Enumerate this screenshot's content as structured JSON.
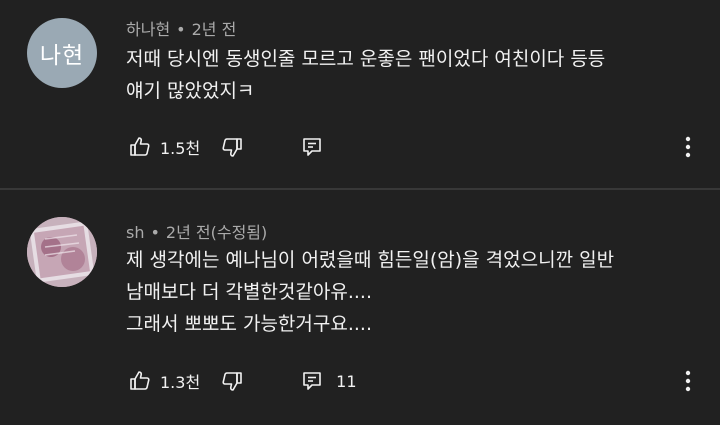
{
  "comments": [
    {
      "avatar_text": "나현",
      "author": "하나현",
      "time": "2년 전",
      "text_lines": [
        "저때 당시엔 동생인줄 모르고 운좋은 팬이었다 여친이다 등등",
        "얘기 많았었지ㅋ"
      ],
      "likes": "1.5천",
      "replies": ""
    },
    {
      "author": "sh",
      "time": "2년 전(수정됨)",
      "text_lines": [
        "제 생각에는 예나님이 어렸을때 힘든일(암)을 격었으니깐 일반",
        "남매보다 더 각별한것같아유....",
        "그래서 뽀뽀도 가능한거구요...."
      ],
      "likes": "1.3천",
      "replies": "11"
    }
  ],
  "colors": {
    "background": "#212121",
    "divider": "#383838",
    "text": "#f1f1f1",
    "meta": "#aaaaaa",
    "avatar1": "#9aa9b4",
    "avatar2": "#b89aa8"
  },
  "icons": [
    "like-icon",
    "dislike-icon",
    "reply-icon",
    "more-options-icon"
  ]
}
